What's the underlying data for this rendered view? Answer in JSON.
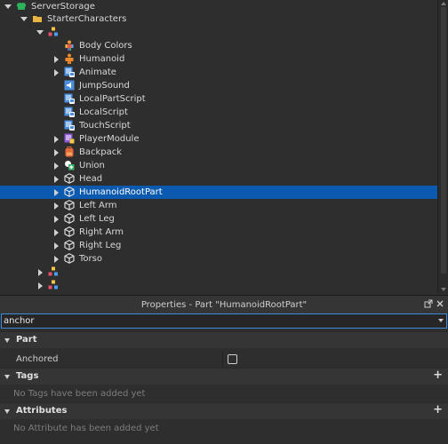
{
  "explorer": {
    "items": [
      {
        "label": "ServerStorage",
        "icon": "server-storage-icon",
        "expander": "down"
      },
      {
        "label": "StarterCharacters",
        "icon": "folder-icon",
        "expander": "down"
      },
      {
        "label": "",
        "icon": "model-icon",
        "expander": "down"
      },
      {
        "label": "Body Colors",
        "icon": "body-colors-icon",
        "expander": "none"
      },
      {
        "label": "Humanoid",
        "icon": "humanoid-icon",
        "expander": "right"
      },
      {
        "label": "Animate",
        "icon": "local-script-icon",
        "expander": "right"
      },
      {
        "label": "JumpSound",
        "icon": "sound-icon",
        "expander": "none"
      },
      {
        "label": "LocalPartScript",
        "icon": "local-script-icon",
        "expander": "none"
      },
      {
        "label": "LocalScript",
        "icon": "local-script-icon",
        "expander": "none"
      },
      {
        "label": "TouchScript",
        "icon": "local-script-icon",
        "expander": "none"
      },
      {
        "label": "PlayerModule",
        "icon": "module-script-icon",
        "expander": "right"
      },
      {
        "label": "Backpack",
        "icon": "backpack-icon",
        "expander": "right"
      },
      {
        "label": "Union",
        "icon": "union-icon",
        "expander": "right"
      },
      {
        "label": "Head",
        "icon": "part-icon",
        "expander": "right"
      },
      {
        "label": "HumanoidRootPart",
        "icon": "part-icon",
        "expander": "right",
        "selected": true
      },
      {
        "label": "Left Arm",
        "icon": "part-icon",
        "expander": "right"
      },
      {
        "label": "Left Leg",
        "icon": "part-icon",
        "expander": "right"
      },
      {
        "label": "Right Arm",
        "icon": "part-icon",
        "expander": "right"
      },
      {
        "label": "Right Leg",
        "icon": "part-icon",
        "expander": "right"
      },
      {
        "label": "Torso",
        "icon": "part-icon",
        "expander": "right"
      },
      {
        "label": "",
        "icon": "model-icon",
        "expander": "right"
      },
      {
        "label": "",
        "icon": "model-icon",
        "expander": "right"
      }
    ]
  },
  "properties": {
    "title": "Properties - Part \"HumanoidRootPart\"",
    "filter_value": "anchor",
    "sections": {
      "part": "Part",
      "tags": "Tags",
      "attributes": "Attributes"
    },
    "anchored_label": "Anchored",
    "anchored_checked": false,
    "tags_empty": "No Tags have been added yet",
    "attributes_empty": "No Attribute has been added yet",
    "plus": "+"
  },
  "colors": {
    "selection": "#0b5aaf",
    "background": "#2e2e2e",
    "accent_border": "#3b8be0"
  }
}
